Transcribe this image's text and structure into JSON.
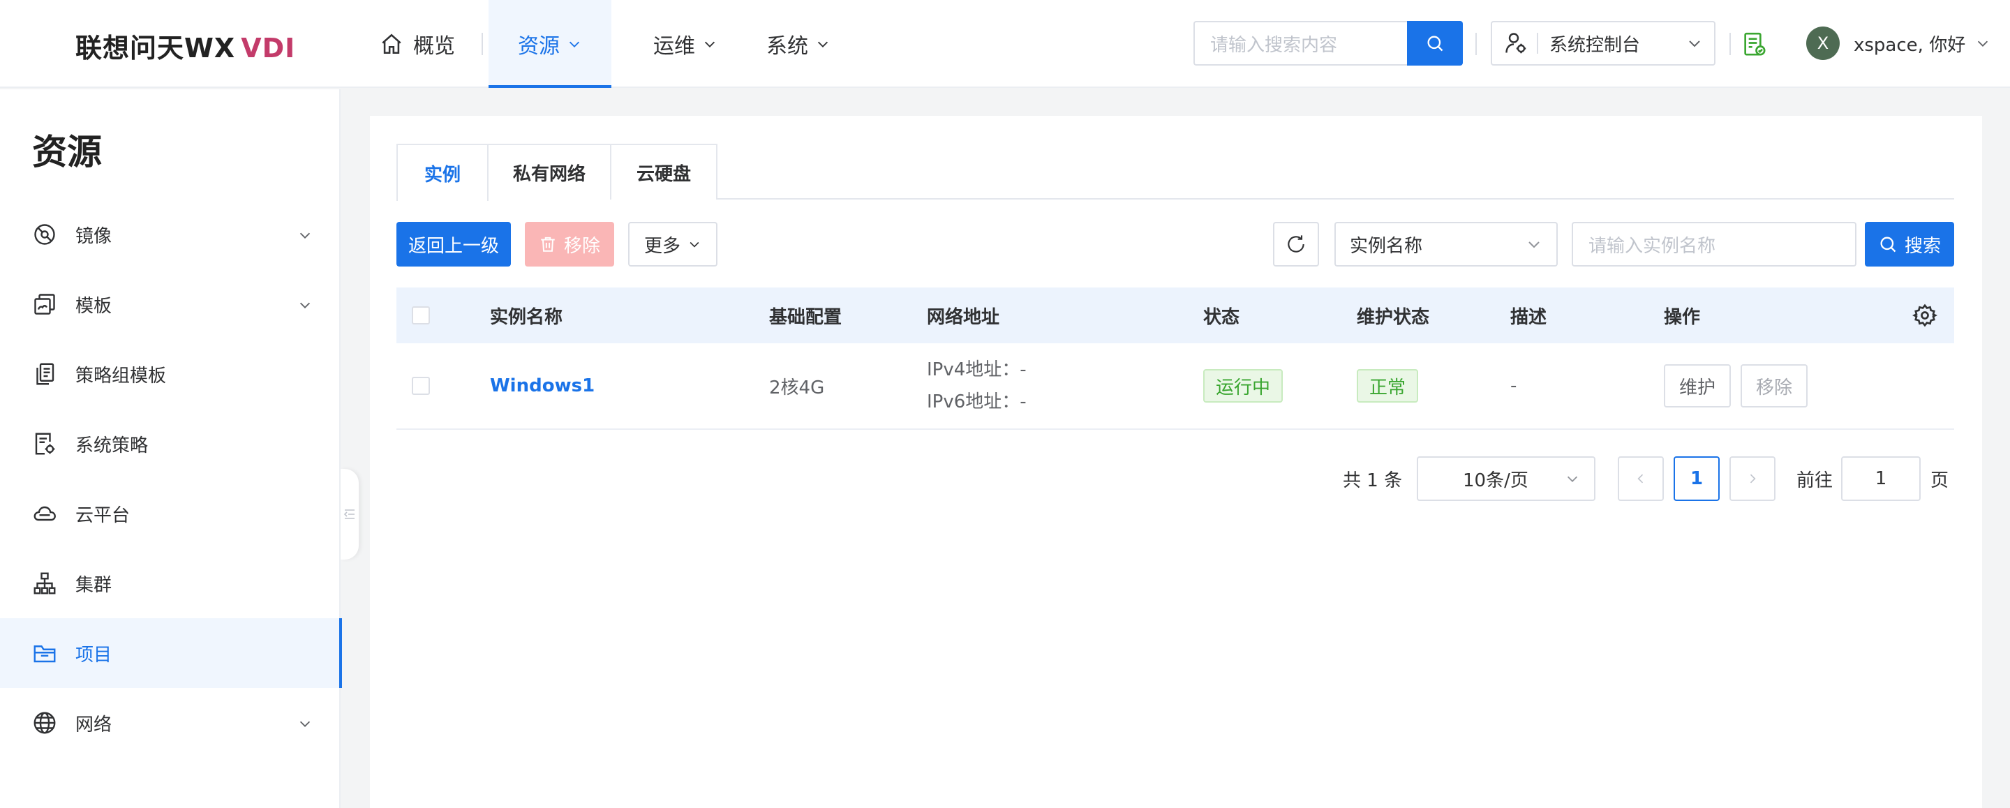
{
  "header": {
    "logo_text": "联想问天WX",
    "logo_suffix": "VDI",
    "nav": {
      "home": "概览",
      "resources": "资源",
      "ops": "运维",
      "system": "系统"
    },
    "search_placeholder": "请输入搜索内容",
    "console_label": "系统控制台",
    "user_initial": "X",
    "user_greeting": "xspace, 你好"
  },
  "sidebar": {
    "title": "资源",
    "items": [
      {
        "label": "镜像",
        "icon": "disc-icon",
        "expandable": true
      },
      {
        "label": "模板",
        "icon": "template-icon",
        "expandable": true
      },
      {
        "label": "策略组模板",
        "icon": "policy-group-icon",
        "expandable": false
      },
      {
        "label": "系统策略",
        "icon": "system-policy-icon",
        "expandable": false
      },
      {
        "label": "云平台",
        "icon": "cloud-icon",
        "expandable": false
      },
      {
        "label": "集群",
        "icon": "cluster-icon",
        "expandable": false
      },
      {
        "label": "项目",
        "icon": "folder-icon",
        "expandable": false,
        "active": true
      },
      {
        "label": "网络",
        "icon": "globe-icon",
        "expandable": true
      }
    ]
  },
  "tabs": [
    "实例",
    "私有网络",
    "云硬盘"
  ],
  "toolbar": {
    "back": "返回上一级",
    "remove": "移除",
    "more": "更多",
    "filter_field": "实例名称",
    "search_placeholder": "请输入实例名称",
    "search": "搜索"
  },
  "table": {
    "columns": [
      "实例名称",
      "基础配置",
      "网络地址",
      "状态",
      "维护状态",
      "描述",
      "操作"
    ],
    "rows": [
      {
        "name": "Windows1",
        "config": "2核4G",
        "ipv4": "IPv4地址：-",
        "ipv6": "IPv6地址：-",
        "status": "运行中",
        "maintenance": "正常",
        "description": "-",
        "actions": [
          "维护",
          "移除"
        ]
      }
    ]
  },
  "pagination": {
    "total": "共 1 条",
    "page_size": "10条/页",
    "current_page": "1",
    "goto_label": "前往",
    "goto_value": "1",
    "page_suffix": "页"
  },
  "colors": {
    "primary": "#1a73e8",
    "danger_disabled": "#fab6b6",
    "success": "#3aa630",
    "logo_accent": "#c33b6a"
  }
}
